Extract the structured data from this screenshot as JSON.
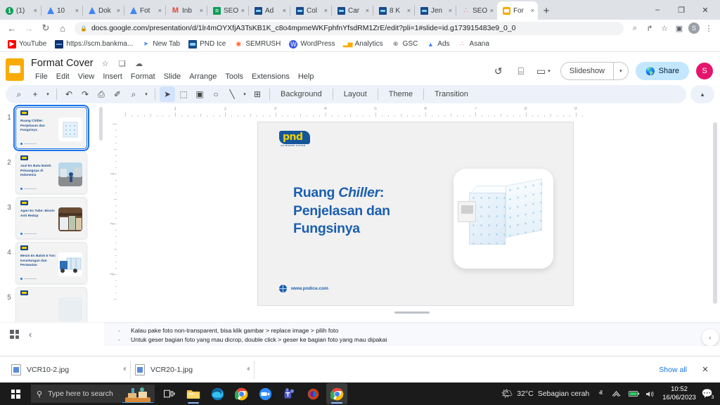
{
  "browser": {
    "tabs": [
      {
        "label": "(1) ",
        "icon": "youtube-notification-icon",
        "icon_kind": "green-badge",
        "active": false
      },
      {
        "label": "10",
        "icon": "google-drive-icon",
        "icon_kind": "drive",
        "active": false
      },
      {
        "label": "Dok",
        "icon": "google-drive-icon",
        "icon_kind": "drive",
        "active": false
      },
      {
        "label": "Fot",
        "icon": "google-drive-icon",
        "icon_kind": "drive",
        "active": false
      },
      {
        "label": "Inb",
        "icon": "gmail-icon",
        "icon_kind": "gmail",
        "active": false
      },
      {
        "label": "SEO",
        "icon": "google-sheets-icon",
        "icon_kind": "sheet",
        "active": false
      },
      {
        "label": "Ad",
        "icon": "pnd-site-icon",
        "icon_kind": "blue",
        "active": false
      },
      {
        "label": "Col",
        "icon": "pnd-site-icon",
        "icon_kind": "blue",
        "active": false
      },
      {
        "label": "Car",
        "icon": "pnd-site-icon",
        "icon_kind": "blue",
        "active": false
      },
      {
        "label": "8 K",
        "icon": "pnd-site-icon",
        "icon_kind": "blue",
        "active": false
      },
      {
        "label": "Jen",
        "icon": "pnd-site-icon",
        "icon_kind": "blue",
        "active": false
      },
      {
        "label": "SEO",
        "icon": "asana-icon",
        "icon_kind": "asana",
        "active": false
      },
      {
        "label": "For",
        "icon": "google-slides-icon",
        "icon_kind": "slides",
        "active": true
      }
    ],
    "new_tab_label": "+",
    "close_label": "×",
    "window_controls": {
      "list": "ⱟ",
      "minimize": "–",
      "maximize": "❒",
      "close": "✕"
    },
    "nav": {
      "back": "←",
      "forward": "→",
      "reload": "↻",
      "home": "⌂"
    },
    "omnibox": {
      "lock": "🔒",
      "url": "docs.google.com/presentation/d/1lr4mOYXfjA3TsKB1K_c8o4mpmeWKFphfnYfsdRM1ZrE/edit?pli=1#slide=id.g173915483e9_0_0",
      "placeholder": "Search Google or type a URL"
    },
    "omni_actions": {
      "search": "⌕",
      "share": "↱",
      "bookmark": "☆",
      "sidepanel": "▣",
      "profile": "S",
      "menu": "⋮"
    },
    "bookmarks": [
      {
        "label": "YouTube",
        "icon": "youtube-icon",
        "icon_kind": "yt",
        "glyph": "▶"
      },
      {
        "label": "https://scm.bankma...",
        "icon": "bank-icon",
        "icon_kind": "bank",
        "glyph": ""
      },
      {
        "label": "New Tab",
        "icon": "chrome-newtab-icon",
        "icon_kind": "newtab",
        "glyph": "➤"
      },
      {
        "label": "PND Ice",
        "icon": "pnd-ice-icon",
        "icon_kind": "pnd",
        "glyph": ""
      },
      {
        "label": "SEMRUSH",
        "icon": "semrush-icon",
        "icon_kind": "sem",
        "glyph": "◉"
      },
      {
        "label": "WordPress",
        "icon": "wordpress-icon",
        "icon_kind": "wp",
        "glyph": "W"
      },
      {
        "label": "Analytics",
        "icon": "google-analytics-icon",
        "icon_kind": "an",
        "glyph": "▂▅"
      },
      {
        "label": "GSC",
        "icon": "search-console-icon",
        "icon_kind": "gsc",
        "glyph": "⊕"
      },
      {
        "label": "Ads",
        "icon": "google-ads-icon",
        "icon_kind": "ads",
        "glyph": "▲"
      },
      {
        "label": "Asana",
        "icon": "asana-icon",
        "icon_kind": "asana",
        "glyph": "∴"
      }
    ]
  },
  "slides": {
    "doc_title": "Format Cover",
    "title_icons": [
      {
        "name": "star-icon",
        "glyph": "☆"
      },
      {
        "name": "move-to-folder-icon",
        "glyph": "❑"
      },
      {
        "name": "cloud-saved-icon",
        "glyph": "☁"
      }
    ],
    "menus": [
      "File",
      "Edit",
      "View",
      "Insert",
      "Format",
      "Slide",
      "Arrange",
      "Tools",
      "Extensions",
      "Help"
    ],
    "header_icons": [
      {
        "name": "version-history-icon",
        "glyph": "↺"
      },
      {
        "name": "comment-history-icon",
        "glyph": "⌸"
      },
      {
        "name": "present-to-meeting-icon",
        "glyph": "▭"
      }
    ],
    "slideshow_label": "Slideshow",
    "slideshow_arrow": "▾",
    "share_label": "Share",
    "share_icon": "globe-lock-icon",
    "avatar_letter": "S",
    "toolbar": {
      "items": [
        {
          "name": "search-icon",
          "glyph": "⌕",
          "selected": false
        },
        {
          "name": "new-slide-icon",
          "glyph": "+",
          "selected": false
        },
        {
          "name": "new-slide-dropdown-icon",
          "glyph": "▾",
          "selected": false,
          "tiny": true
        },
        {
          "name": "undo-icon",
          "glyph": "↶",
          "selected": false
        },
        {
          "name": "redo-icon",
          "glyph": "↷",
          "selected": false
        },
        {
          "name": "print-icon",
          "glyph": "⎙",
          "selected": false
        },
        {
          "name": "paint-format-icon",
          "glyph": "✐",
          "selected": false
        },
        {
          "name": "zoom-icon",
          "glyph": "⌕",
          "selected": false
        },
        {
          "name": "zoom-dropdown-icon",
          "glyph": "▾",
          "selected": false,
          "tiny": true
        },
        {
          "name": "select-cursor-icon",
          "glyph": "➤",
          "selected": true
        },
        {
          "name": "text-box-icon",
          "glyph": "⬚",
          "selected": false
        },
        {
          "name": "insert-image-icon",
          "glyph": "▣",
          "selected": false
        },
        {
          "name": "shape-icon",
          "glyph": "○",
          "selected": false
        },
        {
          "name": "line-icon",
          "glyph": "╲",
          "selected": false
        },
        {
          "name": "line-dropdown-icon",
          "glyph": "▾",
          "selected": false,
          "tiny": true
        },
        {
          "name": "add-comment-icon",
          "glyph": "⊞",
          "selected": false
        }
      ],
      "text_buttons": [
        "Background",
        "Layout",
        "Theme",
        "Transition"
      ],
      "collapse_icon": "▴"
    },
    "filmstrip": {
      "slides": [
        {
          "number": "1",
          "title": "Ruang Chiller: Penjelasan dan Fungsinya",
          "active": true
        },
        {
          "number": "2",
          "title": "Jual Es Batu Balok: Peluangnya di Indonesia",
          "active": false
        },
        {
          "number": "3",
          "title": "Agen Es Tube: Bisnis Anti Redup",
          "active": false
        },
        {
          "number": "4",
          "title": "Mesin Es Balok 5 Ton: Keuntungan dan Perawatan",
          "active": false
        },
        {
          "number": "5",
          "title": "",
          "active": false
        }
      ],
      "bottom": {
        "grid_icon": "filmstrip-view-icon",
        "collapse_icon": "‹"
      }
    },
    "ruler": {
      "h_labels": [
        "1",
        "2",
        "3",
        "4",
        "5",
        "6",
        "7",
        "8",
        "9"
      ],
      "v_labels": [
        "1",
        "2",
        "3",
        "4",
        "5"
      ]
    },
    "slide": {
      "logo_text": "pnd",
      "logo_tagline": "ICE MAKING SYSTEM",
      "title_part1": "Ruang ",
      "title_italic": "Chiller",
      "title_part2": ":",
      "title_line2": "Penjelasan dan",
      "title_line3": "Fungsinya",
      "footer_url": "www.pndice.com",
      "accent_color": "#1b5fae",
      "background_color": "#f1f1f1"
    },
    "notes": [
      "Kalau pake foto non-transparent, bisa klik gambar > replace image > pilih foto",
      "Untuk geser bagian foto yang mau dicrop, double click > geser ke bagian foto yang mau dipakai"
    ],
    "notes_bullet": "-",
    "notes_collapse_icon": "‹"
  },
  "downloads": {
    "items": [
      {
        "name": "VCR10-2.jpg",
        "caret": "ⱏ"
      },
      {
        "name": "VCR20-1.jpg",
        "caret": "ⱏ"
      }
    ],
    "show_all_label": "Show all",
    "close_label": "✕"
  },
  "taskbar": {
    "start_icon": "windows-start-icon",
    "search_placeholder": "Type here to search",
    "search_icon": "search-icon",
    "apps": [
      {
        "name": "task-view-icon",
        "kind": "taskview"
      },
      {
        "name": "file-explorer-icon",
        "kind": "explorer",
        "running": true
      },
      {
        "name": "microsoft-edge-icon",
        "kind": "edge"
      },
      {
        "name": "google-chrome-icon",
        "kind": "chrome"
      },
      {
        "name": "zoom-icon",
        "kind": "zoom"
      },
      {
        "name": "microsoft-teams-icon",
        "kind": "teams"
      },
      {
        "name": "microsoft-365-icon",
        "kind": "m365"
      },
      {
        "name": "google-chrome-icon",
        "kind": "chrome",
        "active": true,
        "running": true
      }
    ],
    "weather": {
      "temp": "32°C",
      "desc": "Sebagian cerah",
      "icon": "partly-cloudy-icon"
    },
    "tray": [
      {
        "name": "show-hidden-icons",
        "glyph": "ⱏ"
      },
      {
        "name": "wifi-icon",
        "glyph": "◴"
      },
      {
        "name": "battery-icon",
        "glyph": "▭"
      },
      {
        "name": "volume-icon",
        "glyph": "🔈"
      }
    ],
    "clock": {
      "time": "10:52",
      "date": "16/06/2023"
    },
    "notification": {
      "icon": "action-center-icon",
      "count": "3"
    }
  }
}
